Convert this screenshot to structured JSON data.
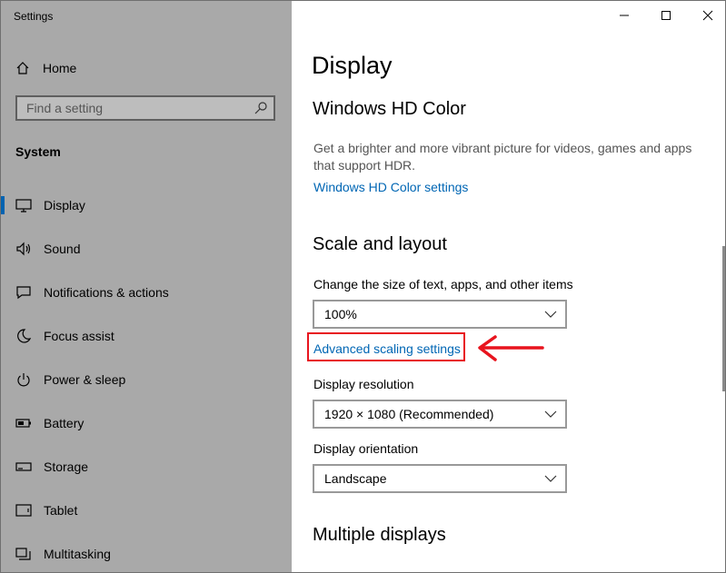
{
  "window": {
    "title": "Settings"
  },
  "sidebar": {
    "home_label": "Home",
    "search_placeholder": "Find a setting",
    "section_title": "System",
    "items": [
      {
        "label": "Display",
        "icon": "monitor-icon",
        "active": true
      },
      {
        "label": "Sound",
        "icon": "speaker-icon"
      },
      {
        "label": "Notifications & actions",
        "icon": "notification-icon"
      },
      {
        "label": "Focus assist",
        "icon": "moon-icon"
      },
      {
        "label": "Power & sleep",
        "icon": "power-icon"
      },
      {
        "label": "Battery",
        "icon": "battery-icon"
      },
      {
        "label": "Storage",
        "icon": "storage-icon"
      },
      {
        "label": "Tablet",
        "icon": "tablet-icon"
      },
      {
        "label": "Multitasking",
        "icon": "multitasking-icon"
      }
    ]
  },
  "main": {
    "page_title": "Display",
    "hdr": {
      "heading": "Windows HD Color",
      "description": "Get a brighter and more vibrant picture for videos, games and apps that support HDR.",
      "link": "Windows HD Color settings"
    },
    "scale": {
      "heading": "Scale and layout",
      "size_label": "Change the size of text, apps, and other items",
      "size_value": "100%",
      "advanced_link": "Advanced scaling settings",
      "resolution_label": "Display resolution",
      "resolution_value": "1920 × 1080 (Recommended)",
      "orientation_label": "Display orientation",
      "orientation_value": "Landscape"
    },
    "multiple": {
      "heading": "Multiple displays"
    }
  },
  "colors": {
    "sidebar_bg": "#a9a9a9",
    "accent": "#0063b1",
    "link": "#0066b4",
    "annotation_red": "#e8141e"
  }
}
